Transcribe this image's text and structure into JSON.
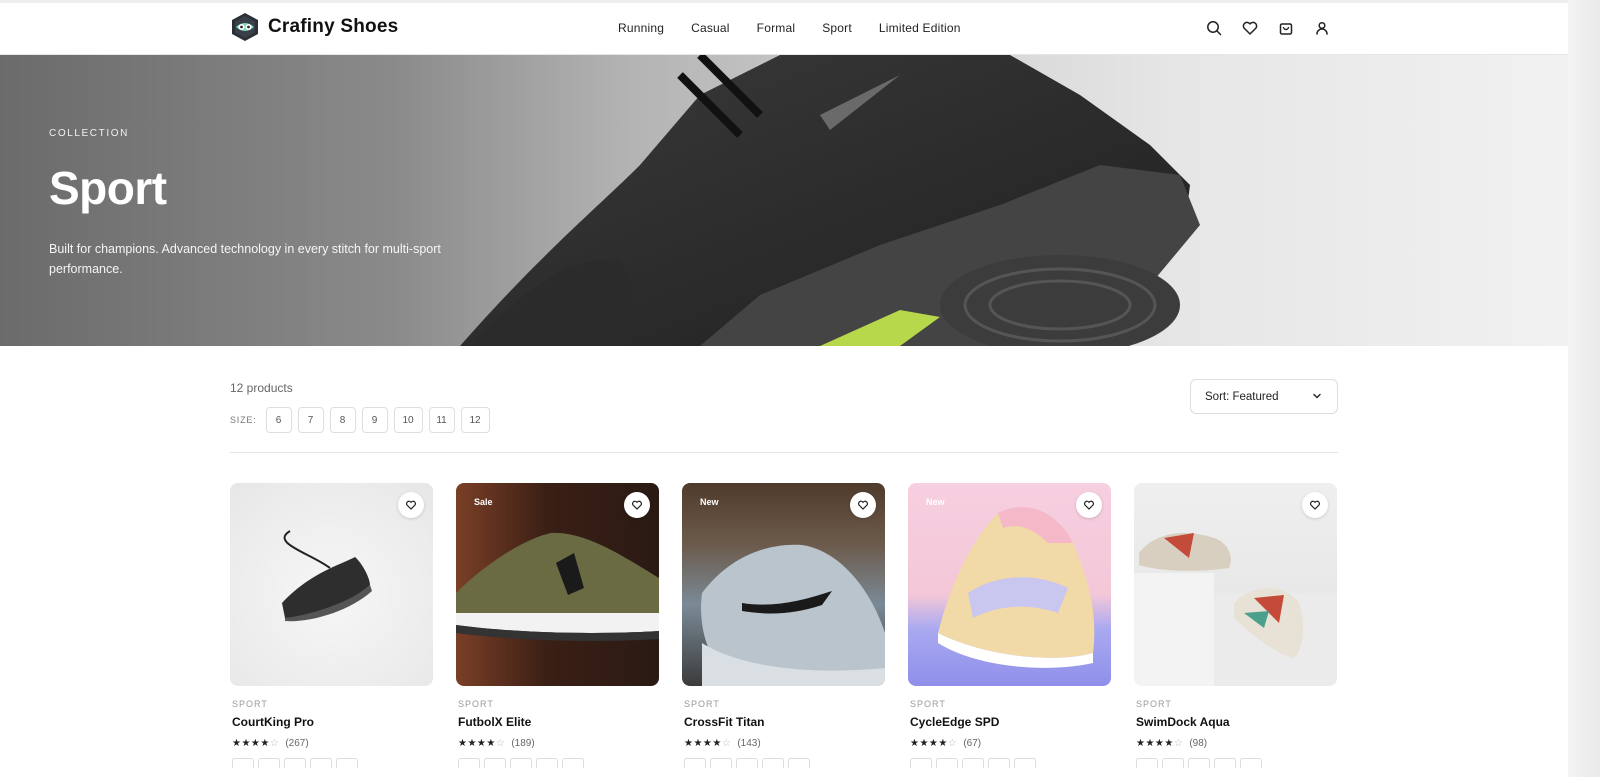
{
  "brand": {
    "name": "Crafiny Shoes",
    "logo_icon": "hexagon-eye-icon"
  },
  "nav": {
    "items": [
      "Running",
      "Casual",
      "Formal",
      "Sport",
      "Limited Edition"
    ]
  },
  "header_icons": [
    "search-icon",
    "heart-icon",
    "bag-icon",
    "user-icon"
  ],
  "hero": {
    "eyebrow": "COLLECTION",
    "title": "Sport",
    "description": "Built for champions. Advanced technology in every stitch for multi-sport performance."
  },
  "toolbar": {
    "count": "12 products",
    "size_label": "SIZE:",
    "sizes": [
      "6",
      "7",
      "8",
      "9",
      "10",
      "11",
      "12"
    ],
    "sort_label": "Sort: Featured"
  },
  "products": [
    {
      "category": "SPORT",
      "name": "CourtKing Pro",
      "stars": 4,
      "reviews": "(267)",
      "badge": ""
    },
    {
      "category": "SPORT",
      "name": "FutbolX Elite",
      "stars": 4,
      "reviews": "(189)",
      "badge": "Sale"
    },
    {
      "category": "SPORT",
      "name": "CrossFit Titan",
      "stars": 4,
      "reviews": "(143)",
      "badge": "New"
    },
    {
      "category": "SPORT",
      "name": "CycleEdge SPD",
      "stars": 4,
      "reviews": "(67)",
      "badge": "New"
    },
    {
      "category": "SPORT",
      "name": "SwimDock Aqua",
      "stars": 4,
      "reviews": "(98)",
      "badge": ""
    }
  ],
  "colors": {
    "accent": "#111111",
    "hero_left": "#6b6b6b",
    "hero_right": "#f1f1f1"
  }
}
